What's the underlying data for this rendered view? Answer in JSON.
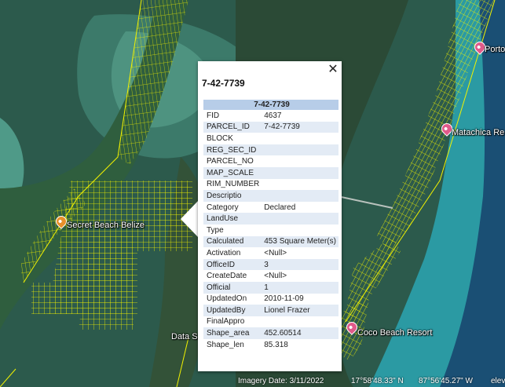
{
  "popup": {
    "title": "7-42-7739",
    "header": "7-42-7739",
    "close_glyph": "✕",
    "rows": [
      {
        "key": "FID",
        "value": "4637"
      },
      {
        "key": "PARCEL_ID",
        "value": "7-42-7739"
      },
      {
        "key": "BLOCK",
        "value": ""
      },
      {
        "key": "REG_SEC_ID",
        "value": ""
      },
      {
        "key": "PARCEL_NO",
        "value": ""
      },
      {
        "key": "MAP_SCALE",
        "value": ""
      },
      {
        "key": "RIM_NUMBER",
        "value": ""
      },
      {
        "key": "Descriptio",
        "value": ""
      },
      {
        "key": "Category",
        "value": "Declared"
      },
      {
        "key": "LandUse",
        "value": ""
      },
      {
        "key": "Type",
        "value": ""
      },
      {
        "key": "Calculated",
        "value": "453 Square Meter(s)"
      },
      {
        "key": "Activation",
        "value": "<Null>"
      },
      {
        "key": "OfficeID",
        "value": "3"
      },
      {
        "key": "CreateDate",
        "value": "<Null>"
      },
      {
        "key": "Official",
        "value": "1"
      },
      {
        "key": "UpdatedOn",
        "value": "2010-11-09"
      },
      {
        "key": "UpdatedBy",
        "value": "Lionel Frazer"
      },
      {
        "key": "FinalAppro",
        "value": ""
      },
      {
        "key": "Shape_area",
        "value": "452.60514"
      },
      {
        "key": "Shape_len",
        "value": "85.318"
      }
    ]
  },
  "places": {
    "secret_beach": "Secret Beach Belize",
    "matachica": "Matachica Re",
    "portofino": "Porto",
    "coco_beach": "Coco Beach Resort",
    "data_source_fragment": "Data S"
  },
  "footer": {
    "imagery_date": "Imagery Date: 3/11/2022",
    "lat": "17°58'48.33\" N",
    "lon": "87°56'45.27\" W",
    "elev": "elev"
  },
  "colors": {
    "parcel_lines": "#f2f200",
    "pin_orange": "#e8902a",
    "pin_pink": "#e05a8a",
    "table_header": "#b7cde8",
    "table_alt": "#e3ebf5"
  }
}
